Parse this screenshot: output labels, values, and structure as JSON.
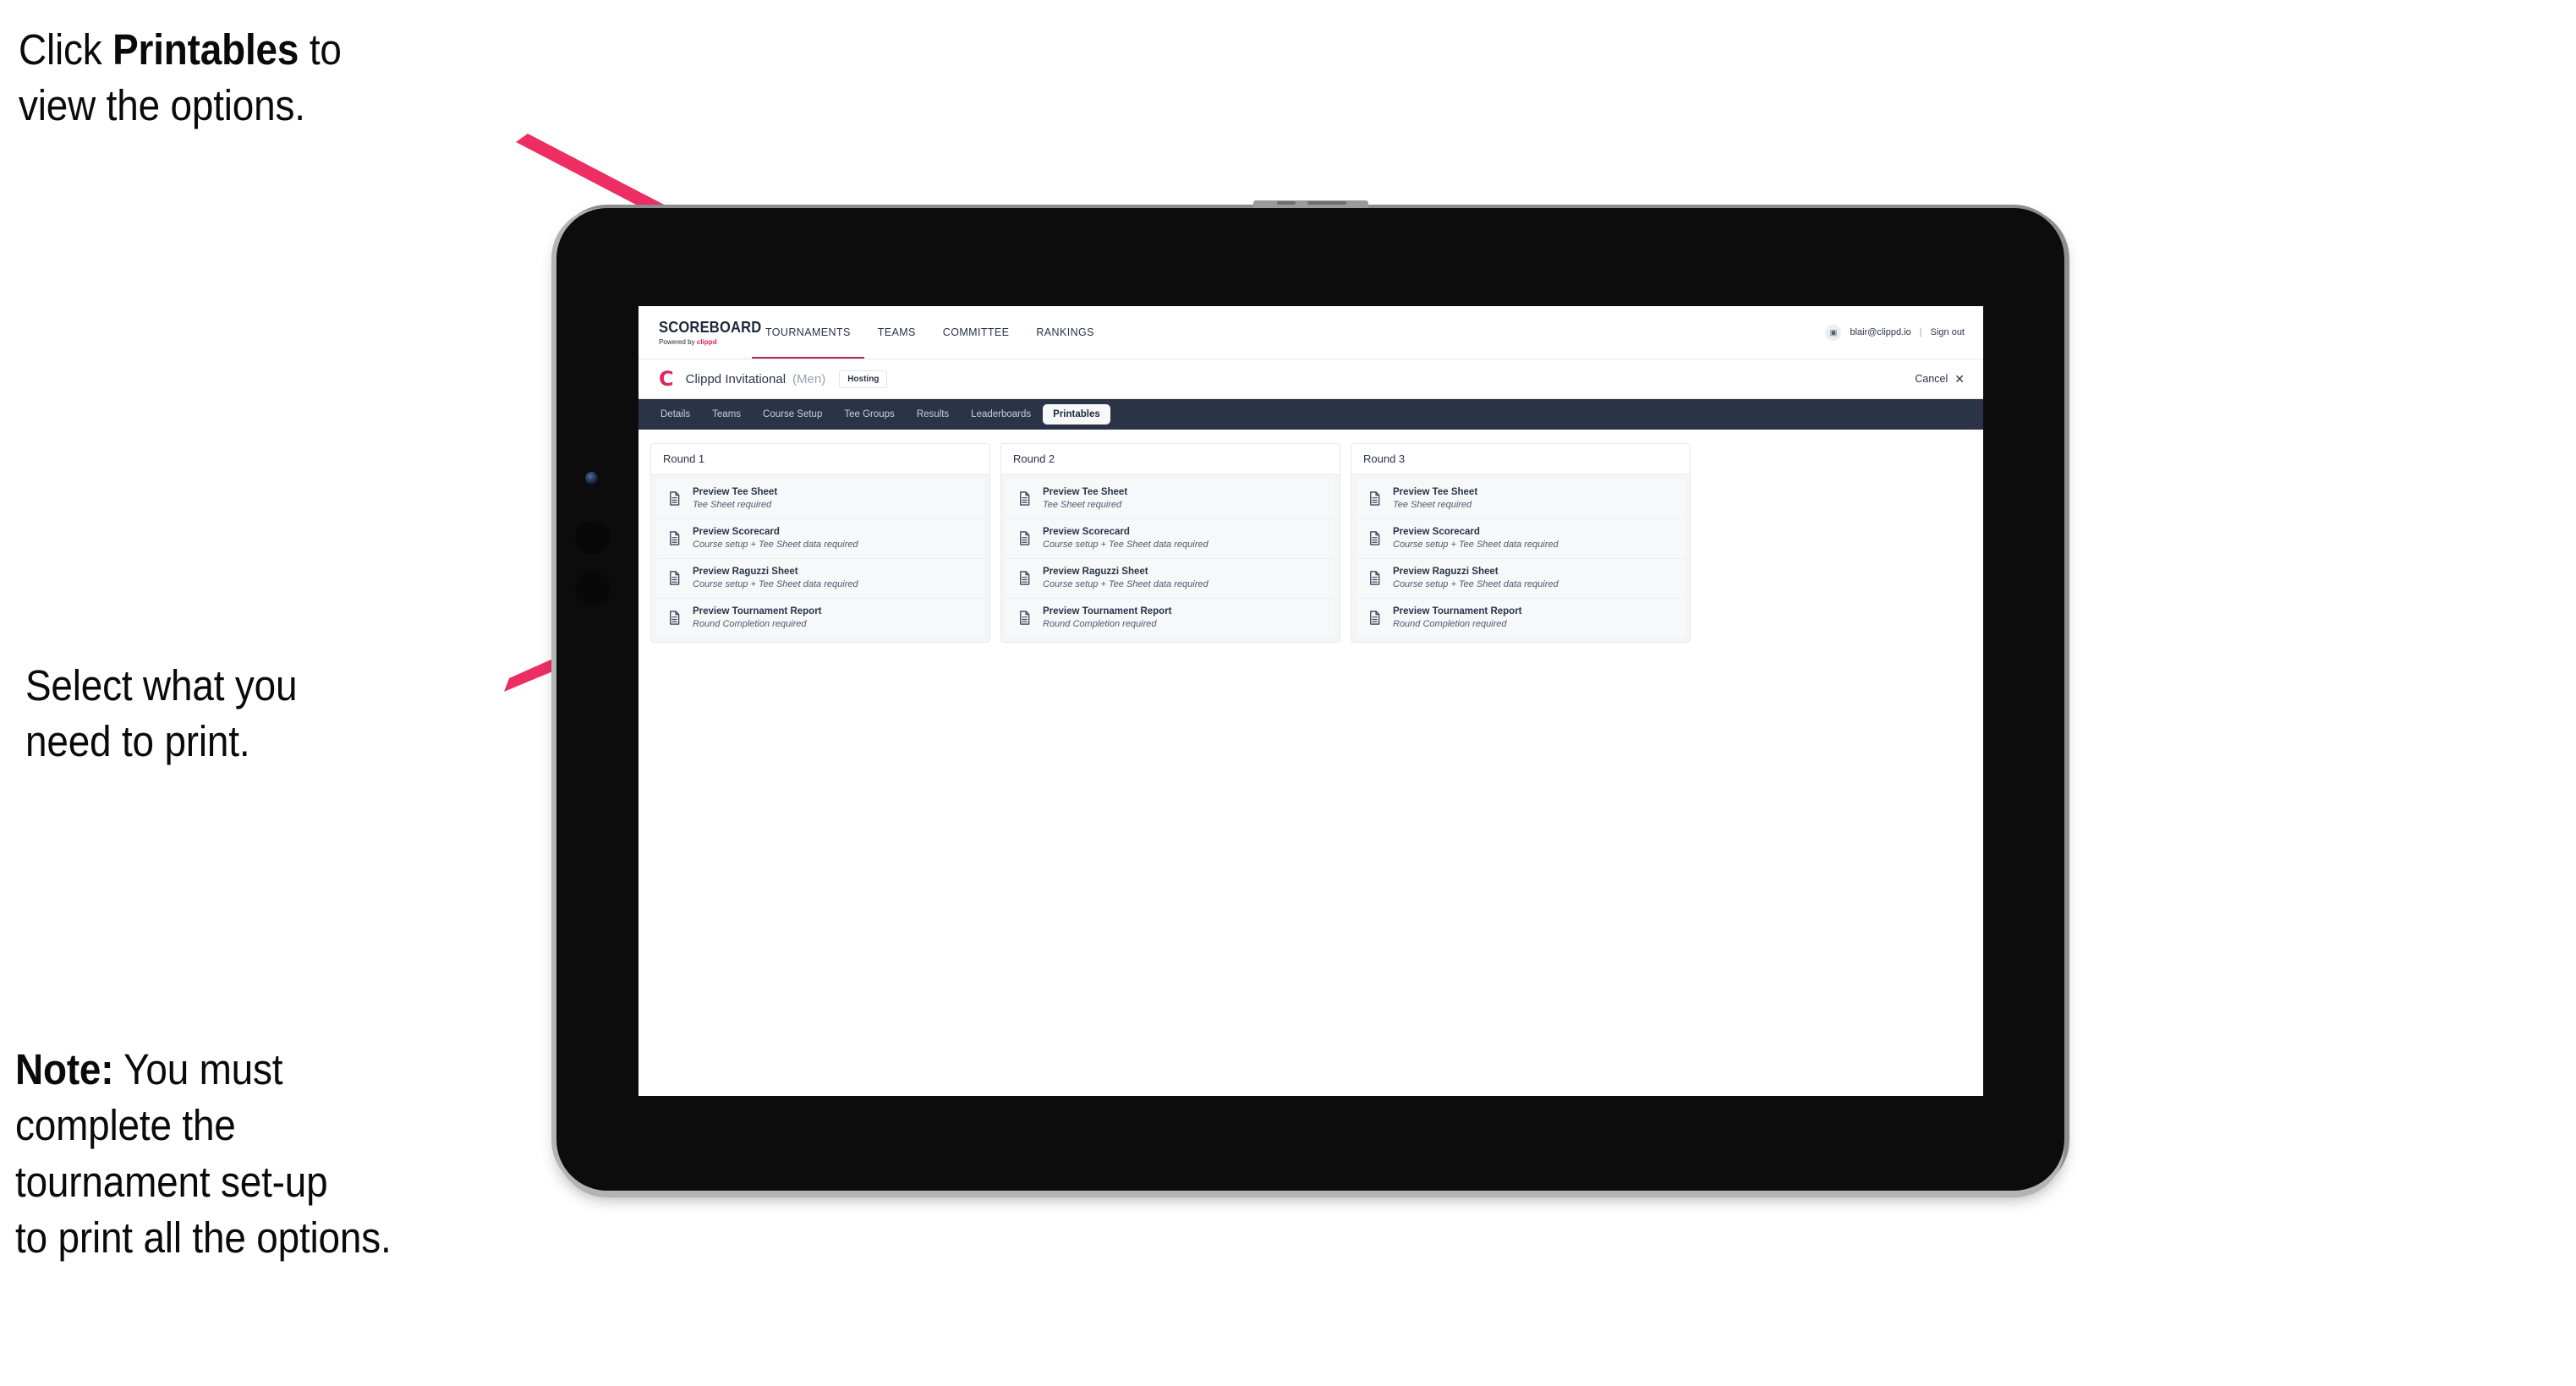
{
  "annotations": [
    {
      "id": "callout-1",
      "text_before": "Click ",
      "bold": "Printables",
      "text_after": " to\nview the options."
    },
    {
      "id": "callout-2",
      "text_before": "",
      "bold": "",
      "text_after": "Select what you\n need to print."
    },
    {
      "id": "callout-3",
      "text_before": "",
      "bold": "Note:",
      "text_after": " You must\ncomplete the\ntournament set-up\nto print all the options."
    }
  ],
  "annotation_color": "#0a0a0a",
  "arrow_color": "#ec2e63",
  "brand": {
    "logo_word": "SCOREBOARD",
    "logo_sub_prefix": "Powered by ",
    "logo_sub_brand": "clippd",
    "nav": [
      {
        "label": "TOURNAMENTS",
        "active": true
      },
      {
        "label": "TEAMS",
        "active": false
      },
      {
        "label": "COMMITTEE",
        "active": false
      },
      {
        "label": "RANKINGS",
        "active": false
      }
    ],
    "avatar_glyph": "▣",
    "user_email": "blair@clippd.io",
    "email_divider": "|",
    "sign_out": "Sign out",
    "accent_underline": "#b3294e",
    "brand_pink": "#e4245c"
  },
  "titlebar": {
    "logo_mark": "C",
    "tournament_name": "Clippd Invitational",
    "gender": "(Men)",
    "role_badge": "Hosting",
    "cancel_label": "Cancel",
    "cancel_icon": "✕"
  },
  "section_nav": {
    "background": "#2b3447",
    "tabs": [
      {
        "label": "Details",
        "active": false
      },
      {
        "label": "Teams",
        "active": false
      },
      {
        "label": "Course Setup",
        "active": false
      },
      {
        "label": "Tee Groups",
        "active": false
      },
      {
        "label": "Results",
        "active": false
      },
      {
        "label": "Leaderboards",
        "active": false
      },
      {
        "label": "Printables",
        "active": true
      }
    ]
  },
  "printables": {
    "rounds": [
      {
        "header": "Round 1",
        "items": [
          {
            "icon": "document-icon",
            "title": "Preview Tee Sheet",
            "subtitle": "Tee Sheet required"
          },
          {
            "icon": "document-icon",
            "title": "Preview Scorecard",
            "subtitle": "Course setup + Tee Sheet data required"
          },
          {
            "icon": "document-icon",
            "title": "Preview Raguzzi Sheet",
            "subtitle": "Course setup + Tee Sheet data required"
          },
          {
            "icon": "document-icon",
            "title": "Preview Tournament Report",
            "subtitle": "Round Completion required"
          }
        ]
      },
      {
        "header": "Round 2",
        "items": [
          {
            "icon": "document-icon",
            "title": "Preview Tee Sheet",
            "subtitle": "Tee Sheet required"
          },
          {
            "icon": "document-icon",
            "title": "Preview Scorecard",
            "subtitle": "Course setup + Tee Sheet data required"
          },
          {
            "icon": "document-icon",
            "title": "Preview Raguzzi Sheet",
            "subtitle": "Course setup + Tee Sheet data required"
          },
          {
            "icon": "document-icon",
            "title": "Preview Tournament Report",
            "subtitle": "Round Completion required"
          }
        ]
      },
      {
        "header": "Round 3",
        "items": [
          {
            "icon": "document-icon",
            "title": "Preview Tee Sheet",
            "subtitle": "Tee Sheet required"
          },
          {
            "icon": "document-icon",
            "title": "Preview Scorecard",
            "subtitle": "Course setup + Tee Sheet data required"
          },
          {
            "icon": "document-icon",
            "title": "Preview Raguzzi Sheet",
            "subtitle": "Course setup + Tee Sheet data required"
          },
          {
            "icon": "document-icon",
            "title": "Preview Tournament Report",
            "subtitle": "Round Completion required"
          }
        ]
      }
    ]
  }
}
